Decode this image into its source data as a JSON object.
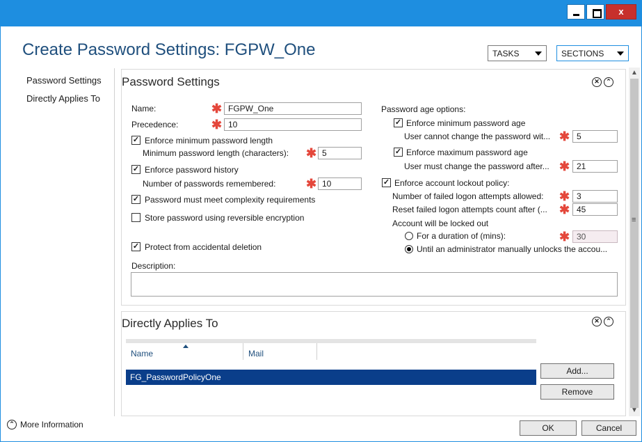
{
  "window": {
    "close_label": "x"
  },
  "header": {
    "title": "Create Password Settings: FGPW_One",
    "tasks_label": "TASKS",
    "sections_label": "SECTIONS"
  },
  "nav": {
    "items": [
      "Password Settings",
      "Directly Applies To"
    ]
  },
  "password_settings": {
    "title": "Password Settings",
    "name_label": "Name:",
    "name_value": "FGPW_One",
    "precedence_label": "Precedence:",
    "precedence_value": "10",
    "enforce_min_length_label": "Enforce minimum password length",
    "enforce_min_length_checked": true,
    "min_length_label": "Minimum password length (characters):",
    "min_length_value": "5",
    "enforce_history_label": "Enforce password history",
    "enforce_history_checked": true,
    "history_label": "Number of passwords remembered:",
    "history_value": "10",
    "complexity_label": "Password must meet complexity requirements",
    "complexity_checked": true,
    "reversible_label": "Store password using reversible encryption",
    "reversible_checked": false,
    "protect_label": "Protect from accidental deletion",
    "protect_checked": true,
    "description_label": "Description:",
    "age_options_label": "Password age options:",
    "enforce_min_age_label": "Enforce minimum password age",
    "enforce_min_age_checked": true,
    "min_age_label": "User cannot change the password wit...",
    "min_age_value": "5",
    "enforce_max_age_label": "Enforce maximum password age",
    "enforce_max_age_checked": true,
    "max_age_label": "User must change the password after...",
    "max_age_value": "21",
    "lockout_label": "Enforce account lockout policy:",
    "lockout_checked": true,
    "failed_attempts_label": "Number of failed logon attempts allowed:",
    "failed_attempts_value": "3",
    "reset_count_label": "Reset failed logon attempts count after (...",
    "reset_count_value": "45",
    "locked_out_label": "Account will be locked out",
    "duration_label": "For a duration of (mins):",
    "duration_value": "30",
    "until_admin_label": "Until an administrator manually unlocks the accou...",
    "selected_lockout_mode": "until_admin"
  },
  "directly_applies_to": {
    "title": "Directly Applies To",
    "columns": [
      "Name",
      "Mail"
    ],
    "rows": [
      {
        "name": "FG_PasswordPolicyOne",
        "mail": ""
      }
    ],
    "add_label": "Add...",
    "remove_label": "Remove"
  },
  "footer": {
    "more_info_label": "More Information",
    "ok_label": "OK",
    "cancel_label": "Cancel"
  }
}
